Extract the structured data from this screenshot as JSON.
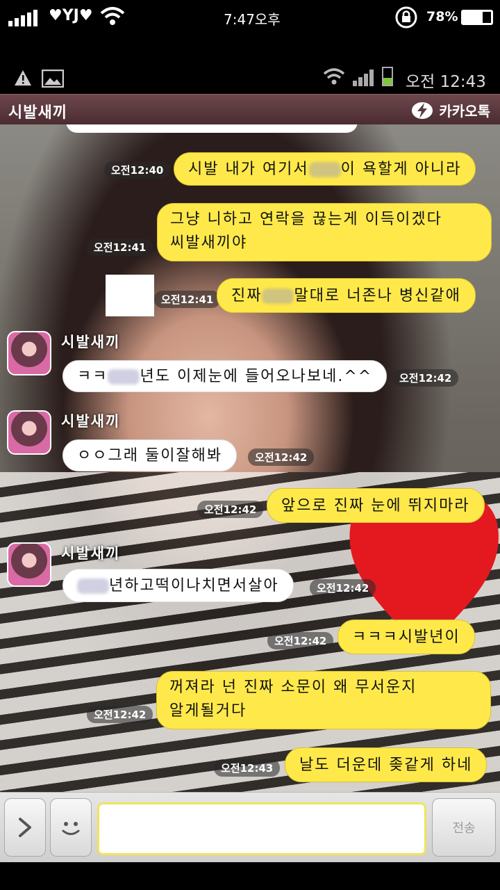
{
  "outer_status": {
    "carrier": "YJ",
    "time": "7:47오후",
    "battery": "78%"
  },
  "inner_status": {
    "time": "오전 12:43"
  },
  "header": {
    "room_title": "시발새끼",
    "brand": "카카오톡"
  },
  "messages": [
    {
      "side": "me",
      "time": "오전12:40",
      "text_a": "시발 내가 여기서",
      "text_b": "이 욕할게 아니라"
    },
    {
      "side": "me",
      "time": "오전12:41",
      "line1": "그냥 니하고 연락을 끊는게 이득이겠다",
      "line2": "씨발새끼야"
    },
    {
      "side": "me",
      "time": "오전12:41",
      "text_a": "진짜",
      "text_b": "말대로 너존나 병신같애"
    },
    {
      "side": "other",
      "sender": "시발새끼",
      "time": "오전12:42",
      "text_a": "ㅋㅋ",
      "text_b": "년도 이제눈에 들어오나보네.^^"
    },
    {
      "side": "other",
      "sender": "시발새끼",
      "time": "오전12:42",
      "text": "ㅇㅇ그래 둘이잘해봐"
    },
    {
      "side": "me",
      "time": "오전12:42",
      "text": "앞으로 진짜 눈에 뛰지마라"
    },
    {
      "side": "other",
      "sender": "시발새끼",
      "time": "오전12:42",
      "text": "년하고떡이나치면서살아"
    },
    {
      "side": "me",
      "time": "오전12:42",
      "text": "ㅋㅋㅋ시발년이"
    },
    {
      "side": "me",
      "time": "오전12:42",
      "line1": "꺼져라 넌 진짜 소문이 왜 무서운지",
      "line2": "알게될거다"
    },
    {
      "side": "me",
      "time": "오전12:43",
      "text": "날도 더운데 좆같게 하네"
    }
  ],
  "input": {
    "placeholder": "",
    "send_label": "전송"
  },
  "icons": {
    "attach": "chevron-right-icon",
    "emoticon": "smiley-icon",
    "brand": "kakao-bolt-icon"
  },
  "colors": {
    "my_bubble": "#ffe94a",
    "other_bubble": "#ffffff",
    "header": "#5a3a3f"
  }
}
